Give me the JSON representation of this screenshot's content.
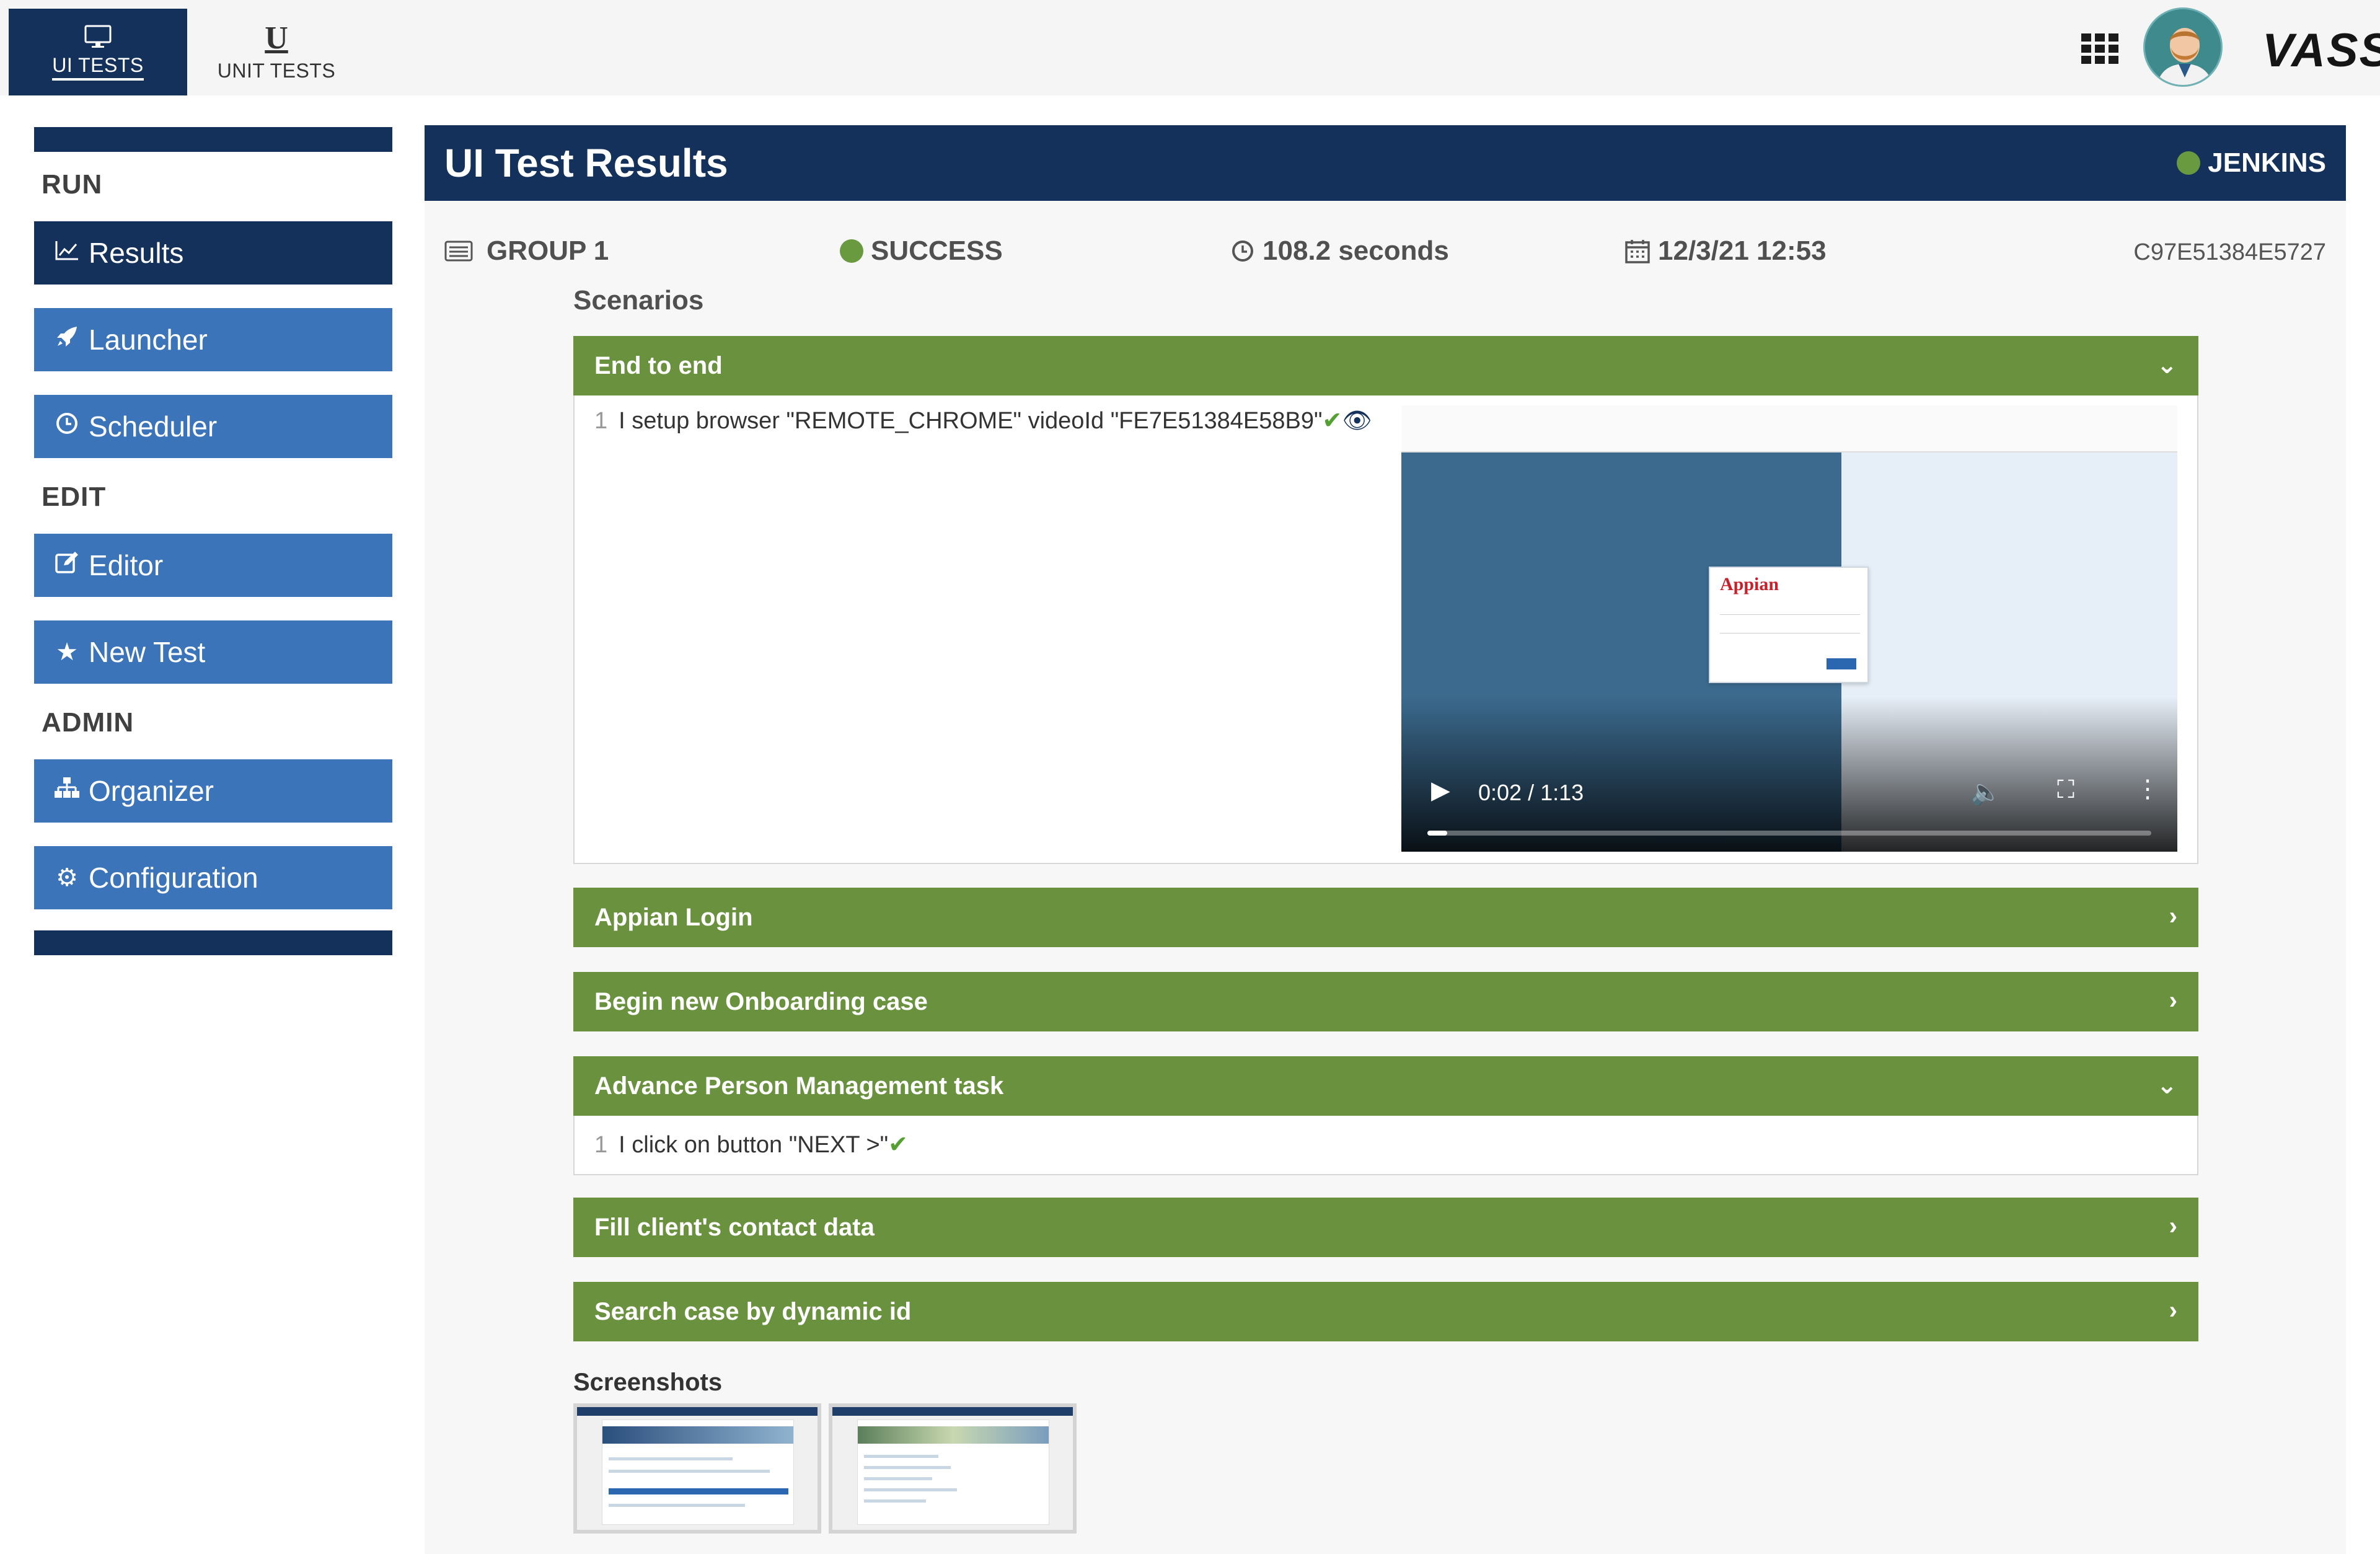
{
  "topnav": {
    "tabs": [
      {
        "label": "UI TESTS",
        "icon": "monitor-icon",
        "active": true
      },
      {
        "label": "UNIT TESTS",
        "icon": "unit-u-icon",
        "glyph": "U",
        "active": false
      }
    ],
    "brand": "VASS"
  },
  "sidebar": {
    "sections": [
      {
        "title": "RUN",
        "items": [
          {
            "label": "Results",
            "icon": "chart-line-icon",
            "active": true
          },
          {
            "label": "Launcher",
            "icon": "rocket-icon"
          },
          {
            "label": "Scheduler",
            "icon": "clock-icon"
          }
        ]
      },
      {
        "title": "EDIT",
        "items": [
          {
            "label": "Editor",
            "icon": "edit-icon"
          },
          {
            "label": "New Test",
            "icon": "star-icon"
          }
        ]
      },
      {
        "title": "ADMIN",
        "items": [
          {
            "label": "Organizer",
            "icon": "sitemap-icon"
          },
          {
            "label": "Configuration",
            "icon": "gear-icon"
          }
        ]
      }
    ]
  },
  "header": {
    "title": "UI Test Results",
    "ci": "JENKINS",
    "ci_status_color": "#6a9a3f"
  },
  "run": {
    "group": "GROUP 1",
    "status": "SUCCESS",
    "duration": "108.2 seconds",
    "date": "12/3/21 12:53",
    "id": "C97E51384E5727"
  },
  "scenarios_label": "Scenarios",
  "scenarios": [
    {
      "title": "End to end",
      "expanded": true,
      "steps": [
        {
          "num": "1",
          "text": "I setup browser \"REMOTE_CHROME\" videoId \"FE7E51384E58B9\""
        }
      ]
    },
    {
      "title": "Appian Login",
      "expanded": false
    },
    {
      "title": "Begin new Onboarding case",
      "expanded": false
    },
    {
      "title": "Advance Person Management task",
      "expanded": true,
      "steps": [
        {
          "num": "1",
          "text": "I click on button \"NEXT >\""
        }
      ]
    },
    {
      "title": "Fill client's contact data",
      "expanded": false
    },
    {
      "title": "Search case by dynamic id",
      "expanded": false
    }
  ],
  "video": {
    "time": "0:02 / 1:13",
    "progress": 0.027,
    "login_logo": "Appian"
  },
  "screenshots_label": "Screenshots",
  "colors": {
    "navy": "#13315a",
    "blue": "#3b74b8",
    "green": "#6a923e",
    "success": "#6a9a3f"
  }
}
